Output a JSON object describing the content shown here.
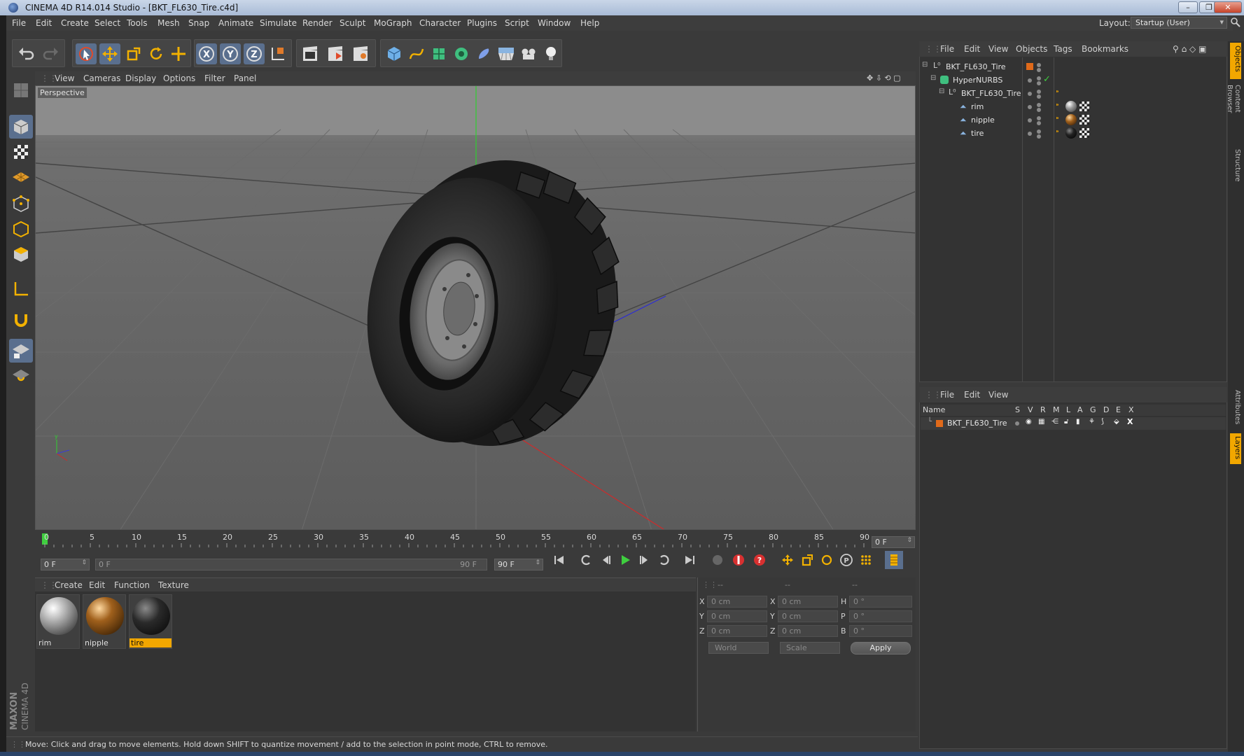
{
  "window": {
    "title": "CINEMA 4D R14.014 Studio - [BKT_FL630_Tire.c4d]",
    "buttons": [
      "–",
      "❐",
      "✕"
    ]
  },
  "menubar": {
    "items": [
      "File",
      "Edit",
      "Create",
      "Select",
      "Tools",
      "Mesh",
      "Snap",
      "Animate",
      "Simulate",
      "Render",
      "Sculpt",
      "MoGraph",
      "Character",
      "Plugins",
      "Script",
      "Window",
      "Help"
    ],
    "layout_label": "Layout:",
    "layout_value": "Startup (User)"
  },
  "viewport": {
    "menu": [
      "View",
      "Cameras",
      "Display",
      "Options",
      "Filter",
      "Panel"
    ],
    "label": "Perspective"
  },
  "timeline": {
    "ticks": [
      "0",
      "5",
      "10",
      "15",
      "20",
      "25",
      "30",
      "35",
      "40",
      "45",
      "50",
      "55",
      "60",
      "65",
      "70",
      "75",
      "80",
      "85",
      "90"
    ],
    "current_frame": "0 F",
    "start_field": "0 F",
    "range_start": "0 F",
    "range_end": "90 F",
    "end_field": "90 F"
  },
  "materials": {
    "menu": [
      "Create",
      "Edit",
      "Function",
      "Texture"
    ],
    "items": [
      {
        "name": "rim",
        "color": "#c8c8c8"
      },
      {
        "name": "nipple",
        "color": "#9a5a1c"
      },
      {
        "name": "tire",
        "color": "#1e1e1e",
        "selected": true
      }
    ]
  },
  "coordinates": {
    "headers": [
      "--",
      "--",
      "--"
    ],
    "rows": [
      {
        "l1": "X",
        "v1": "0 cm",
        "l2": "X",
        "v2": "0 cm",
        "l3": "H",
        "v3": "0 °"
      },
      {
        "l1": "Y",
        "v1": "0 cm",
        "l2": "Y",
        "v2": "0 cm",
        "l3": "P",
        "v3": "0 °"
      },
      {
        "l1": "Z",
        "v1": "0 cm",
        "l2": "Z",
        "v2": "0 cm",
        "l3": "B",
        "v3": "0 °"
      }
    ],
    "mode": "World",
    "type": "Scale",
    "apply": "Apply"
  },
  "status": "Move: Click and drag to move elements. Hold down SHIFT to quantize movement / add to the selection in point mode, CTRL to remove.",
  "object_manager": {
    "menu": [
      "File",
      "Edit",
      "View",
      "Objects",
      "Tags",
      "Bookmarks"
    ],
    "objects": [
      {
        "name": "BKT_FL630_Tire"
      },
      {
        "name": "HyperNURBS"
      },
      {
        "name": "BKT_FL630_Tire"
      },
      {
        "name": "rim"
      },
      {
        "name": "nipple"
      },
      {
        "name": "tire"
      }
    ]
  },
  "layer_manager": {
    "menu": [
      "File",
      "Edit",
      "View"
    ],
    "columns": [
      "Name",
      "S",
      "V",
      "R",
      "M",
      "L",
      "A",
      "G",
      "D",
      "E",
      "X"
    ],
    "layers": [
      {
        "name": "BKT_FL630_Tire",
        "color": "#e06a1a"
      }
    ]
  },
  "side_tabs": [
    "Objects",
    "Content Browser",
    "Structure",
    "Attributes",
    "Layers"
  ],
  "colors": {
    "accent_orange": "#f2a700",
    "selection_blue": "#5a6f8e",
    "play_green": "#3fcf3f"
  }
}
